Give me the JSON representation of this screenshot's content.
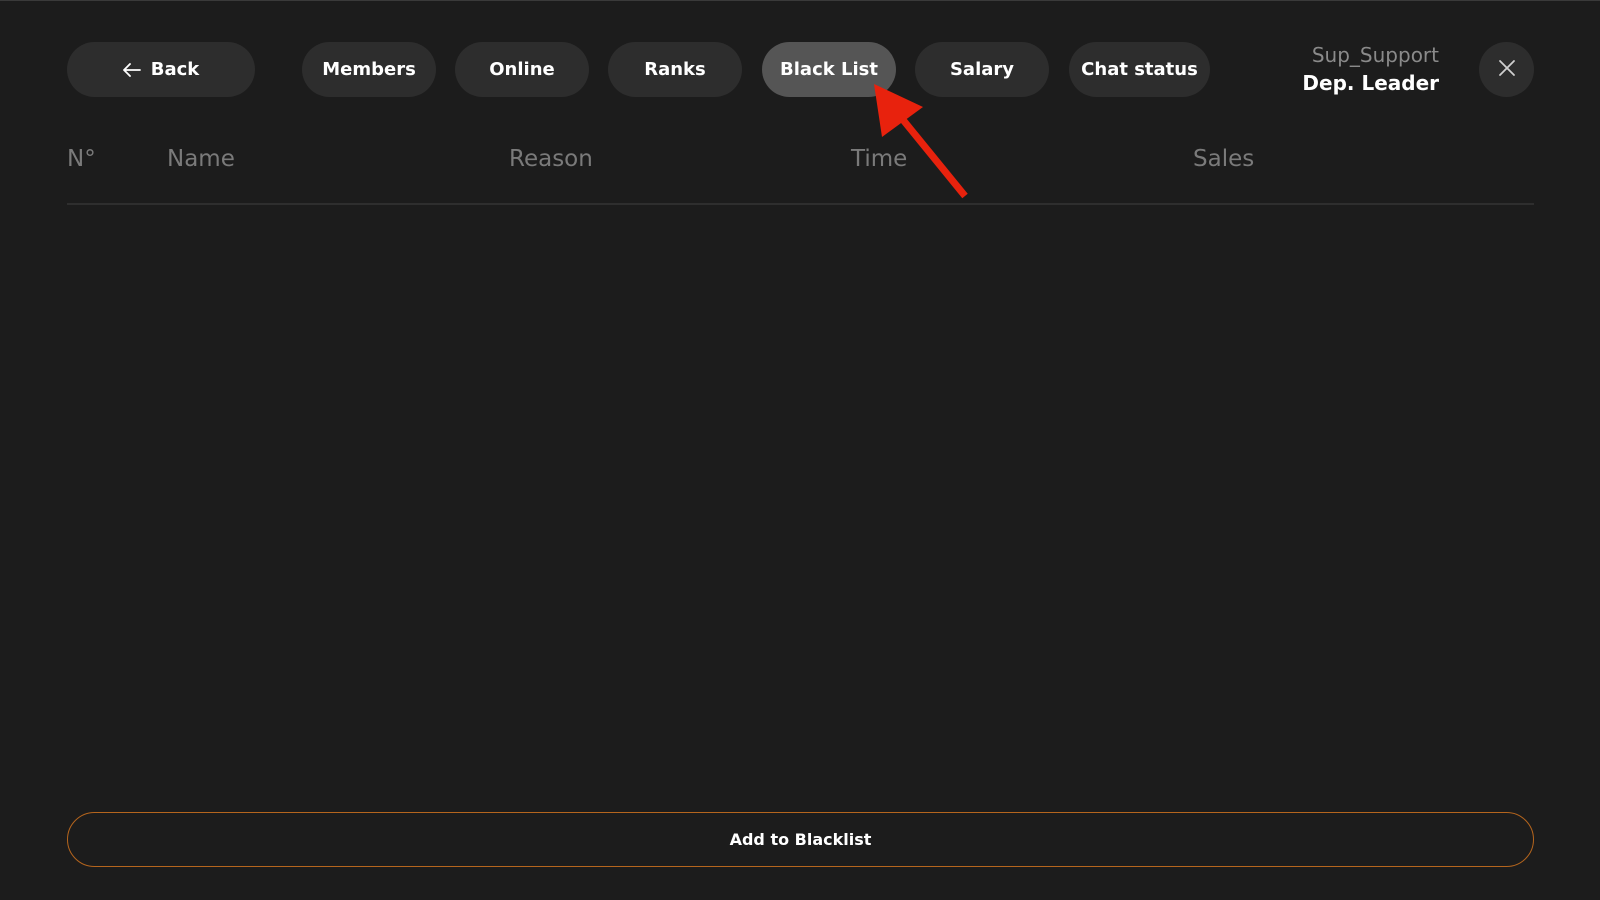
{
  "nav": {
    "back_label": "Back",
    "tabs": [
      {
        "label": "Members"
      },
      {
        "label": "Online"
      },
      {
        "label": "Ranks"
      },
      {
        "label": "Black List",
        "active": true
      },
      {
        "label": "Salary"
      },
      {
        "label": "Chat status"
      }
    ]
  },
  "user": {
    "name": "Sup_Support",
    "rank": "Dep. Leader"
  },
  "table": {
    "columns": [
      "N°",
      "Name",
      "Reason",
      "Time",
      "Sales"
    ],
    "rows": []
  },
  "footer": {
    "add_label": "Add to Blacklist"
  },
  "colors": {
    "background": "#1c1c1c",
    "pill": "#2d2d2d",
    "pill_active": "#555555",
    "accent_border": "#b5651d",
    "annotation_arrow": "#e8220d"
  },
  "icons": {
    "back": "arrow-left-icon",
    "close": "close-icon",
    "annotation": "red-arrow-icon"
  }
}
